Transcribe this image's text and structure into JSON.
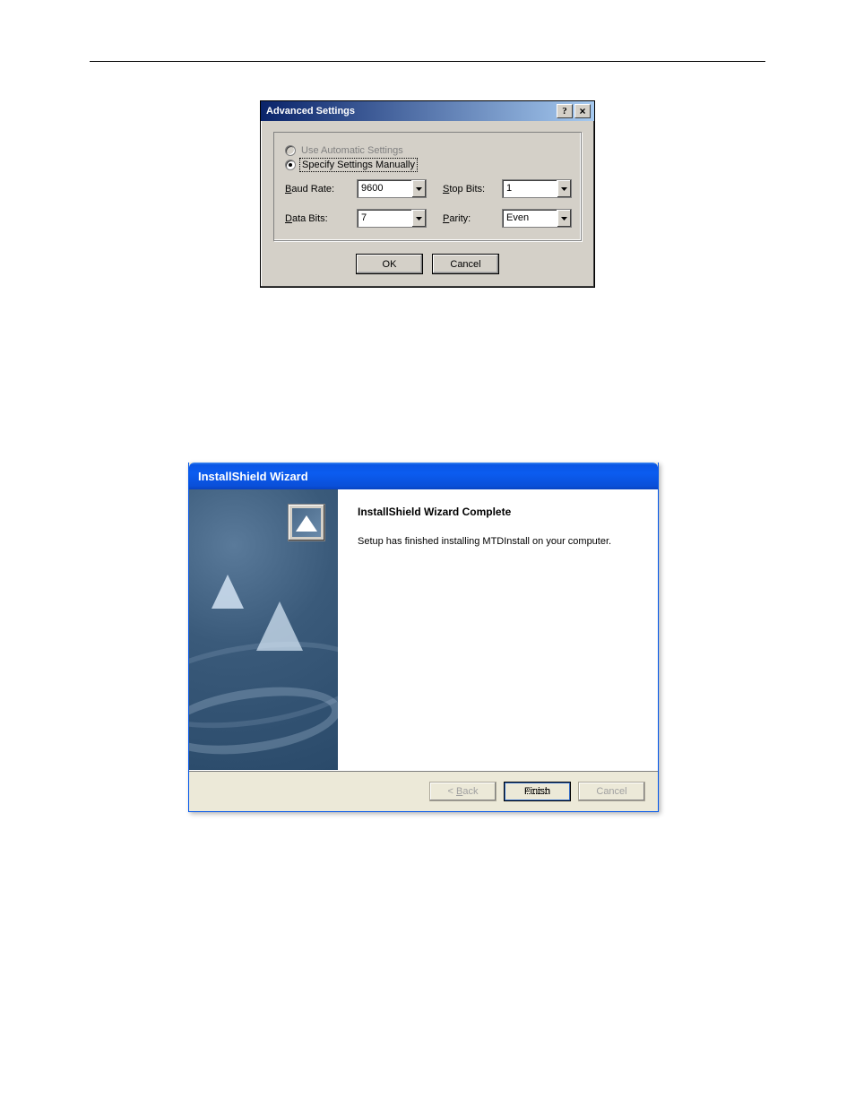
{
  "dlg1": {
    "title": "Advanced Settings",
    "radio_auto": "Use Automatic Settings",
    "radio_manual": "Specify Settings Manually",
    "baud_label_pre": "B",
    "baud_label": "aud Rate:",
    "baud_value": "9600",
    "stopbits_label_pre": "S",
    "stopbits_label": "top Bits:",
    "stopbits_value": "1",
    "databits_label_pre": "D",
    "databits_label": "ata Bits:",
    "databits_value": "7",
    "parity_label_pre": "P",
    "parity_label": "arity:",
    "parity_value": "Even",
    "ok": "OK",
    "cancel": "Cancel"
  },
  "dlg2": {
    "title": "InstallShield Wizard",
    "heading": "InstallShield Wizard Complete",
    "body": "Setup has finished installing MTDInstall on your computer.",
    "back_pre": "< ",
    "back_ul": "B",
    "back_post": "ack",
    "finish": "Finish",
    "cancel": "Cancel"
  }
}
